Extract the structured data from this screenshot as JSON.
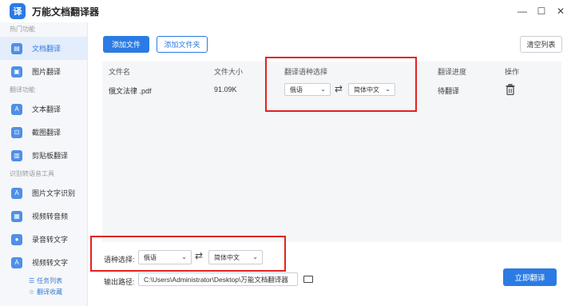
{
  "app": {
    "title": "万能文档翻译器",
    "logo_text": "译"
  },
  "window": {
    "min": "—",
    "max": "☐",
    "close": "✕"
  },
  "sidebar": {
    "sections": [
      {
        "title": "热门功能",
        "items": [
          {
            "label": "文档翻译",
            "icon": "document-icon"
          },
          {
            "label": "图片翻译",
            "icon": "image-icon"
          }
        ]
      },
      {
        "title": "翻译功能",
        "items": [
          {
            "label": "文本翻译",
            "icon": "text-icon"
          },
          {
            "label": "截图翻译",
            "icon": "screenshot-icon"
          },
          {
            "label": "剪贴板翻译",
            "icon": "clipboard-icon"
          }
        ]
      },
      {
        "title": "识别转语音工具",
        "items": [
          {
            "label": "图片文字识别",
            "icon": "ocr-icon"
          },
          {
            "label": "视频转音频",
            "icon": "video-icon"
          },
          {
            "label": "录音转文字",
            "icon": "mic-icon"
          },
          {
            "label": "视频转文字",
            "icon": "video-text-icon"
          }
        ]
      }
    ],
    "bottom": [
      {
        "label": "任务列表"
      },
      {
        "label": "翻译收藏"
      }
    ]
  },
  "toolbar": {
    "add_file": "添加文件",
    "add_folder": "添加文件夹",
    "clear_list": "清空列表"
  },
  "table": {
    "headers": {
      "name": "文件名",
      "size": "文件大小",
      "lang": "翻译语种选择",
      "progress": "翻译进度",
      "action": "操作"
    },
    "rows": [
      {
        "name": "俄文法律 .pdf",
        "size": "91.09K",
        "source": "俄语",
        "target": "简体中文",
        "progress": "待翻译"
      }
    ]
  },
  "footer": {
    "lang_label": "语种选择:",
    "source": "俄语",
    "target": "简体中文",
    "path_label": "输出路径:",
    "path": "C:\\Users\\Administrator\\Desktop\\万能文档翻译器",
    "translate": "立即翻译"
  },
  "colors": {
    "accent": "#2b7be4",
    "highlight": "#e32121"
  }
}
